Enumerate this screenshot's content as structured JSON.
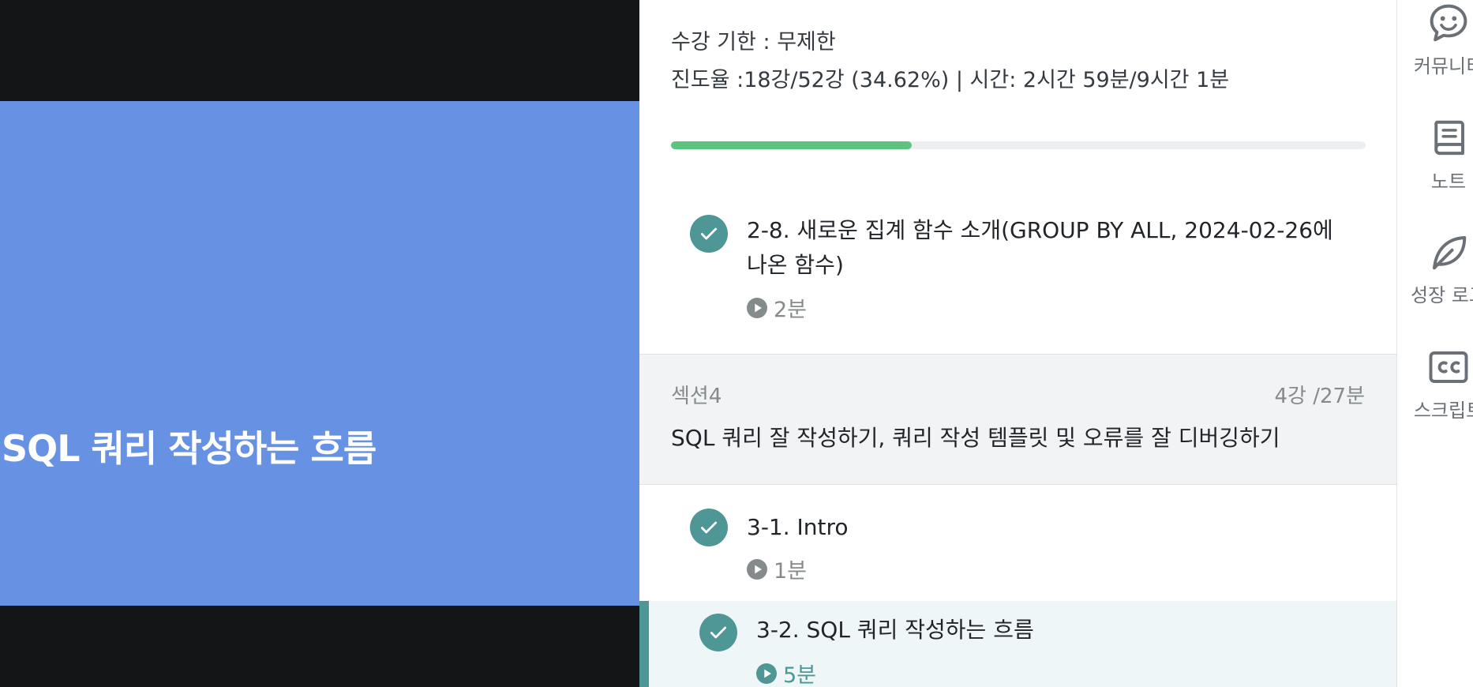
{
  "video": {
    "slide_title": "SQL 쿼리 작성하는 흐름"
  },
  "course": {
    "period": "수강 기한 : 무제한",
    "progress_text": "진도율 :18강/52강 (34.62%) | 시간: 2시간 59분/9시간 1분",
    "progress_percent": 34.62
  },
  "units_before": [
    {
      "title_line1": "2-8. 새로운 집계 함수 소개(GROUP BY ALL, 2024-02-26에",
      "title_line2": "나온 함수)",
      "duration": "2분",
      "completed": true
    }
  ],
  "section": {
    "label": "섹션4",
    "meta": "4강 /27분",
    "title": "SQL 쿼리 잘 작성하기, 쿼리 작성 템플릿 및 오류를 잘 디버깅하기"
  },
  "units": [
    {
      "title": "3-1. Intro",
      "duration": "1분",
      "completed": true
    },
    {
      "title": "3-2. SQL 쿼리 작성하는 흐름",
      "duration": "5분",
      "completed": true,
      "active": true
    }
  ],
  "tools": [
    {
      "label": "커뮤니티",
      "icon": "smile-chat-icon"
    },
    {
      "label": "노트",
      "icon": "book-icon"
    },
    {
      "label": "성장 로그",
      "icon": "leaf-icon"
    },
    {
      "label": "스크립트",
      "icon": "cc-icon"
    }
  ],
  "colors": {
    "slide_bg": "#6792e4",
    "check": "#4f9797",
    "progress": "#5cc47f"
  }
}
